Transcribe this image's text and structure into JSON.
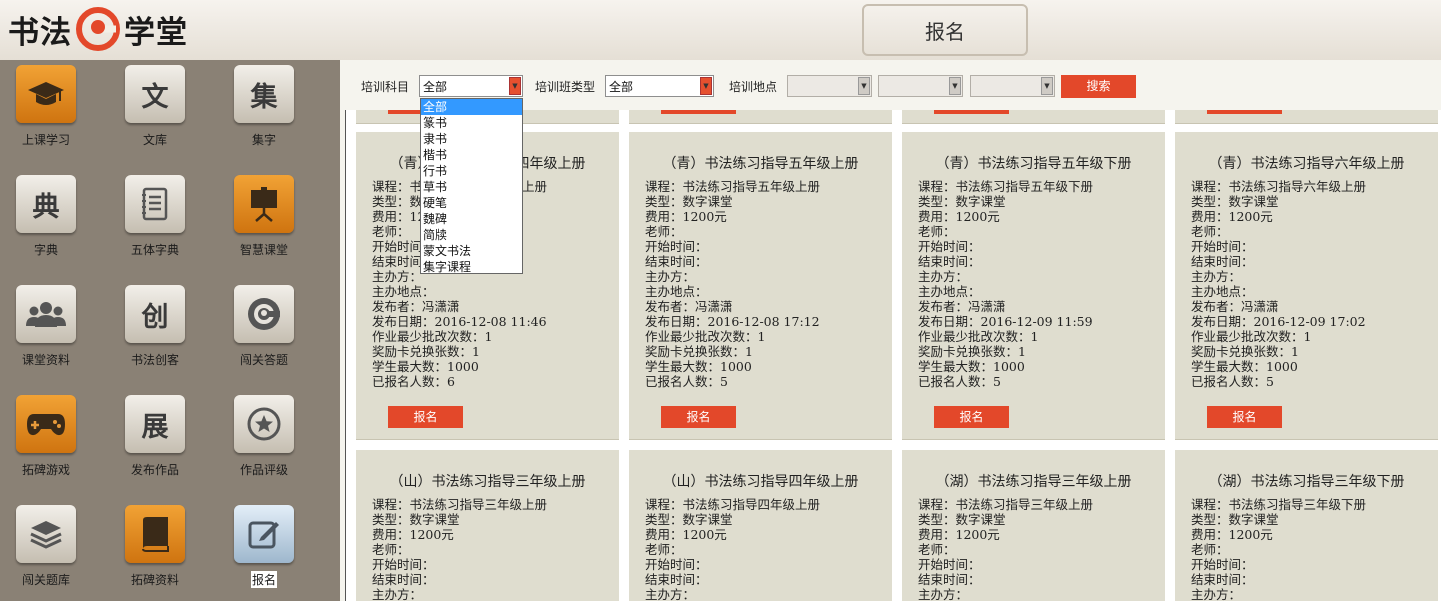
{
  "header": {
    "logo_left": "书法",
    "logo_right": "学堂",
    "page_title": "报名",
    "colors": {
      "accent": "#e3482a",
      "sidebar": "#8a8175",
      "card": "#dfddcf"
    }
  },
  "sidebar": {
    "tiles": [
      {
        "label": "上课学习",
        "icon": "graduation-cap-icon",
        "style": "orange"
      },
      {
        "label": "文库",
        "icon": "wen-character-icon",
        "glyph": "文",
        "style": "gray"
      },
      {
        "label": "集字",
        "icon": "ji-character-icon",
        "glyph": "集",
        "style": "gray"
      },
      {
        "label": "字典",
        "icon": "dian-character-icon",
        "glyph": "典",
        "style": "gray"
      },
      {
        "label": "五体字典",
        "icon": "notebook-icon",
        "style": "gray"
      },
      {
        "label": "智慧课堂",
        "icon": "presentation-easel-icon",
        "style": "orange"
      },
      {
        "label": "课堂资料",
        "icon": "group-users-icon",
        "style": "gray"
      },
      {
        "label": "书法创客",
        "icon": "chuang-character-icon",
        "glyph": "创",
        "style": "gray"
      },
      {
        "label": "闯关答题",
        "icon": "circular-logo-icon",
        "style": "gray"
      },
      {
        "label": "拓碑游戏",
        "icon": "gamepad-icon",
        "style": "orange"
      },
      {
        "label": "发布作品",
        "icon": "zhan-character-icon",
        "glyph": "展",
        "style": "gray"
      },
      {
        "label": "作品评级",
        "icon": "star-badge-icon",
        "style": "gray"
      },
      {
        "label": "闯关题库",
        "icon": "stacked-layers-icon",
        "style": "gray"
      },
      {
        "label": "拓碑资料",
        "icon": "book-icon",
        "style": "orange"
      },
      {
        "label": "报名",
        "icon": "edit-pencil-icon",
        "style": "blue",
        "selected": true
      }
    ]
  },
  "filters": {
    "subject_label": "培训科目",
    "subject_value": "全部",
    "class_type_label": "培训班类型",
    "class_type_value": "全部",
    "location_label": "培训地点",
    "search_label": "搜索",
    "subject_options": [
      "全部",
      "篆书",
      "隶书",
      "楷书",
      "行书",
      "草书",
      "硬笔",
      "魏碑",
      "简牍",
      "蒙文书法",
      "集字课程"
    ]
  },
  "cards": [
    {
      "title": "（青）书法练习指导四年级上册",
      "fields": [
        "课程：书法练习指导四年级上册",
        "类型：数字课堂",
        "费用：1200元",
        "老师：",
        "开始时间：",
        "结束时间：",
        "主办方：",
        "主办地点：",
        "发布者：冯潇潇",
        "发布日期：2016-12-08 11:46",
        "作业最少批改次数：1",
        "奖励卡兑换张数：1",
        "学生最大数：1000",
        "已报名人数：6"
      ],
      "button": "报名"
    },
    {
      "title": "（青）书法练习指导五年级上册",
      "fields": [
        "课程：书法练习指导五年级上册",
        "类型：数字课堂",
        "费用：1200元",
        "老师：",
        "开始时间：",
        "结束时间：",
        "主办方：",
        "主办地点：",
        "发布者：冯潇潇",
        "发布日期：2016-12-08 17:12",
        "作业最少批改次数：1",
        "奖励卡兑换张数：1",
        "学生最大数：1000",
        "已报名人数：5"
      ],
      "button": "报名"
    },
    {
      "title": "（青）书法练习指导五年级下册",
      "fields": [
        "课程：书法练习指导五年级下册",
        "类型：数字课堂",
        "费用：1200元",
        "老师：",
        "开始时间：",
        "结束时间：",
        "主办方：",
        "主办地点：",
        "发布者：冯潇潇",
        "发布日期：2016-12-09 11:59",
        "作业最少批改次数：1",
        "奖励卡兑换张数：1",
        "学生最大数：1000",
        "已报名人数：5"
      ],
      "button": "报名"
    },
    {
      "title": "（青）书法练习指导六年级上册",
      "fields": [
        "课程：书法练习指导六年级上册",
        "类型：数字课堂",
        "费用：1200元",
        "老师：",
        "开始时间：",
        "结束时间：",
        "主办方：",
        "主办地点：",
        "发布者：冯潇潇",
        "发布日期：2016-12-09 17:02",
        "作业最少批改次数：1",
        "奖励卡兑换张数：1",
        "学生最大数：1000",
        "已报名人数：5"
      ],
      "button": "报名"
    },
    {
      "title": "（山）书法练习指导三年级上册",
      "fields": [
        "课程：书法练习指导三年级上册",
        "类型：数字课堂",
        "费用：1200元",
        "老师：",
        "开始时间：",
        "结束时间：",
        "主办方："
      ]
    },
    {
      "title": "（山）书法练习指导四年级上册",
      "fields": [
        "课程：书法练习指导四年级上册",
        "类型：数字课堂",
        "费用：1200元",
        "老师：",
        "开始时间：",
        "结束时间：",
        "主办方："
      ]
    },
    {
      "title": "（湖）书法练习指导三年级上册",
      "fields": [
        "课程：书法练习指导三年级上册",
        "类型：数字课堂",
        "费用：1200元",
        "老师：",
        "开始时间：",
        "结束时间：",
        "主办方："
      ]
    },
    {
      "title": "（湖）书法练习指导三年级下册",
      "fields": [
        "课程：书法练习指导三年级下册",
        "类型：数字课堂",
        "费用：1200元",
        "老师：",
        "开始时间：",
        "结束时间：",
        "主办方："
      ]
    }
  ]
}
